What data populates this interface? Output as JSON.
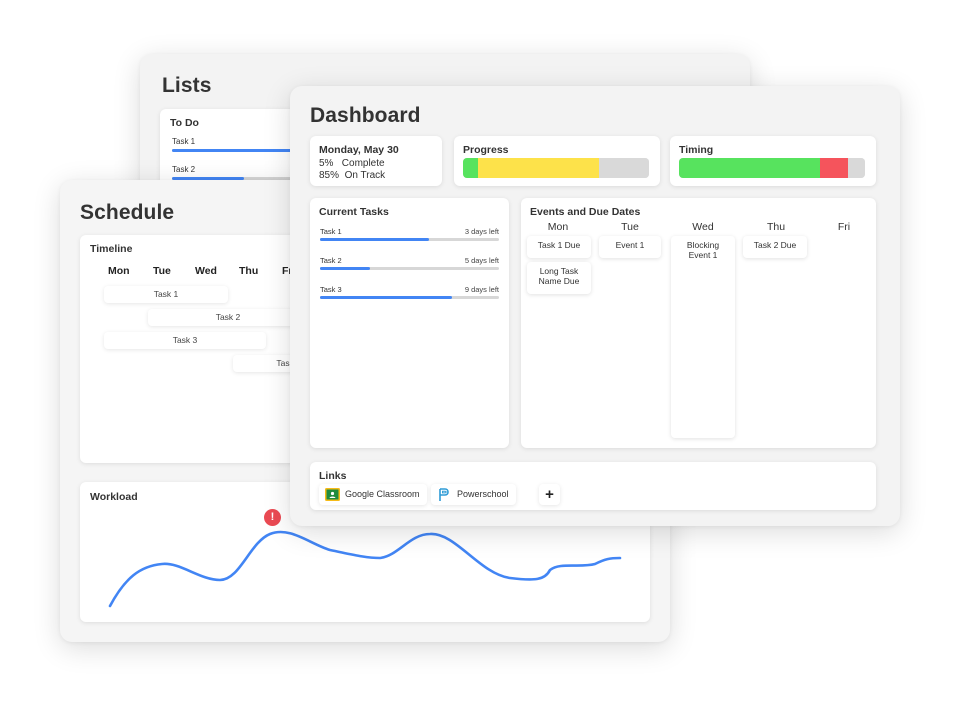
{
  "lists": {
    "title": "Lists",
    "todo": {
      "title": "To Do",
      "items": [
        {
          "label": "Task 1",
          "progress": 0.75
        },
        {
          "label": "Task 2",
          "progress": 0.45
        }
      ]
    }
  },
  "schedule": {
    "title": "Schedule",
    "timeline": {
      "title": "Timeline",
      "days": [
        "Mon",
        "Tue",
        "Wed",
        "Thu",
        "Fr"
      ],
      "tasks": [
        "Task 1",
        "Task 2",
        "Task 3",
        "Tas"
      ]
    },
    "workload": {
      "title": "Workload",
      "alert_icon": "exclamation-icon"
    }
  },
  "dashboard": {
    "title": "Dashboard",
    "date": {
      "title": "Monday, May 30",
      "complete": "5%   Complete",
      "on_track": "85%  On Track"
    },
    "progress": {
      "title": "Progress",
      "segments": [
        {
          "color": "#57e35e",
          "fraction": 0.08
        },
        {
          "color": "#fde24a",
          "fraction": 0.65
        },
        {
          "color": "#d9d9d9",
          "fraction": 0.27
        }
      ]
    },
    "timing": {
      "title": "Timing",
      "segments": [
        {
          "color": "#57e35e",
          "fraction": 0.76
        },
        {
          "color": "#f5545c",
          "fraction": 0.15
        },
        {
          "color": "#d9d9d9",
          "fraction": 0.09
        }
      ]
    },
    "current_tasks": {
      "title": "Current Tasks",
      "tasks": [
        {
          "name": "Task 1",
          "left": "3 days left",
          "progress": 0.61
        },
        {
          "name": "Task 2",
          "left": "5 days left",
          "progress": 0.28
        },
        {
          "name": "Task 3",
          "left": "9 days left",
          "progress": 0.74
        }
      ]
    },
    "events": {
      "title": "Events and Due Dates",
      "days": [
        "Mon",
        "Tue",
        "Wed",
        "Thu",
        "Fri"
      ],
      "items": {
        "mon_1": "Task 1 Due",
        "mon_2a": "Long Task",
        "mon_2b": "Name Due",
        "tue_1": "Event 1",
        "wed_1a": "Blocking",
        "wed_1b": "Event 1",
        "thu_1": "Task 2 Due"
      }
    },
    "links": {
      "title": "Links",
      "items": [
        "Google Classroom",
        "Powerschool"
      ],
      "add_label": "+"
    }
  },
  "colors": {
    "accent_blue": "#4285f4",
    "alert_red": "#ea4a53"
  }
}
